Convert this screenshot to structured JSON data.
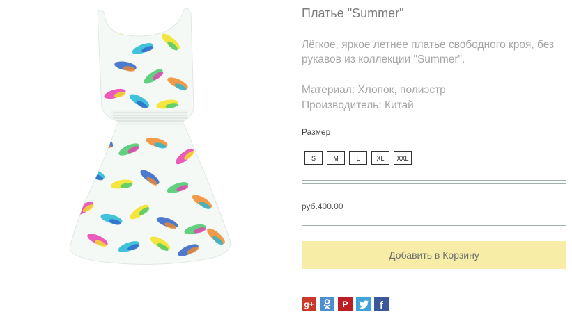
{
  "product": {
    "title": "Платье \"Summer\"",
    "description": "Лёгкое, яркое летнее платье свободного кроя, без рукавов из коллекции \"Summer\".",
    "material": "Материал: Хлопок, полиэстр",
    "manufacturer": "Производитель: Китай",
    "size_label": "Размер",
    "sizes": [
      "S",
      "M",
      "L",
      "XL",
      "XXL"
    ],
    "price": "руб.400.00",
    "add_to_cart": "Добавить в Корзину"
  },
  "share": [
    {
      "icon": "google-plus-icon",
      "glyph": "g+",
      "color": "#c8392b"
    },
    {
      "icon": "odnoklassniki-icon",
      "glyph": "",
      "color": "#4b8fd2"
    },
    {
      "icon": "pinterest-icon",
      "glyph": "P",
      "color": "#bd1e25"
    },
    {
      "icon": "twitter-icon",
      "glyph": "t",
      "color": "#3fa4da"
    },
    {
      "icon": "facebook-icon",
      "glyph": "f",
      "color": "#3b5998"
    }
  ],
  "colors": {
    "add_to_cart_bg": "#f7eda6",
    "separator": "#9fb1ad"
  }
}
